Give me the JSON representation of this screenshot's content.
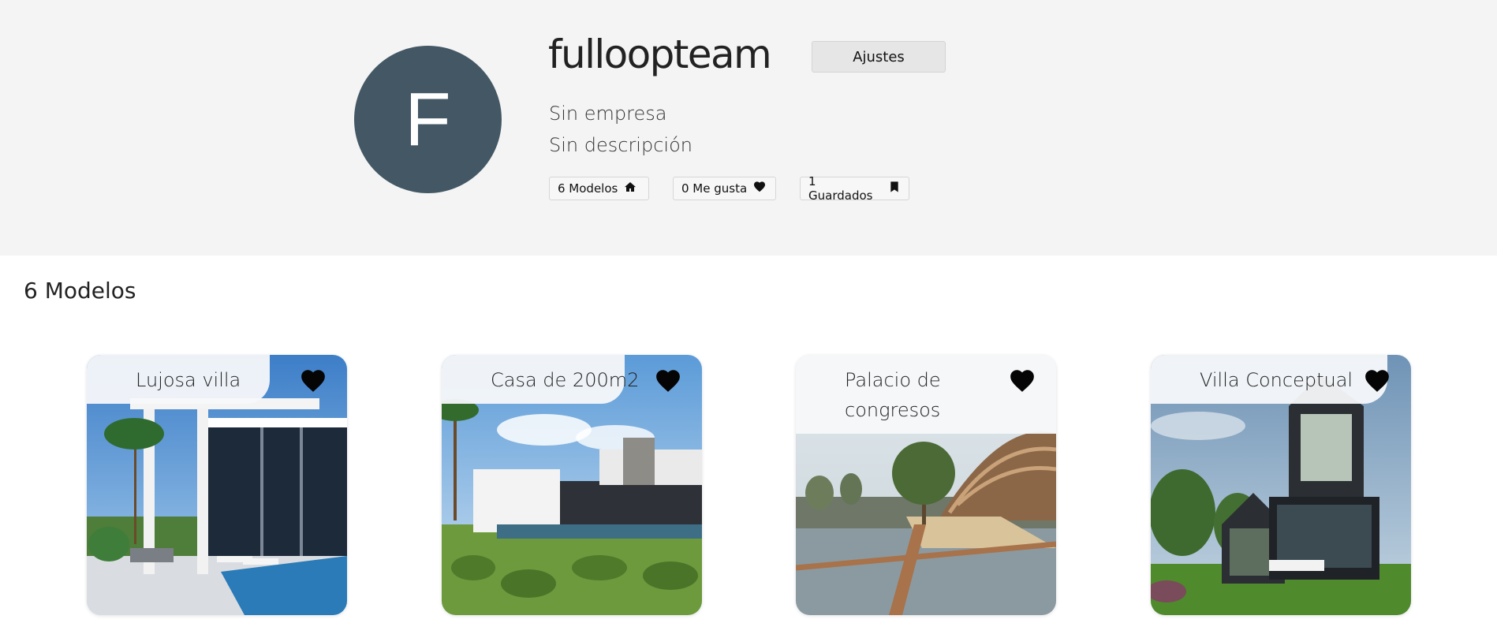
{
  "profile": {
    "avatar_initial": "F",
    "avatar_color": "#435764",
    "username": "fulloopteam",
    "settings_label": "Ajustes",
    "company": "Sin empresa",
    "description": "Sin descripción",
    "stats": [
      {
        "label": "6 Modelos",
        "icon": "home-icon"
      },
      {
        "label": "0 Me gusta",
        "icon": "heart-icon"
      },
      {
        "label": "1 Guardados",
        "icon": "bookmark-icon"
      }
    ]
  },
  "models_section": {
    "title": "6 Modelos",
    "cards": [
      {
        "title": "Lujosa villa",
        "like_icon": "heart-icon"
      },
      {
        "title": "Casa de 200m2",
        "like_icon": "heart-icon"
      },
      {
        "title": "Palacio de congresos",
        "like_icon": "heart-icon"
      },
      {
        "title": "Villa Conceptual",
        "like_icon": "heart-icon"
      }
    ]
  }
}
